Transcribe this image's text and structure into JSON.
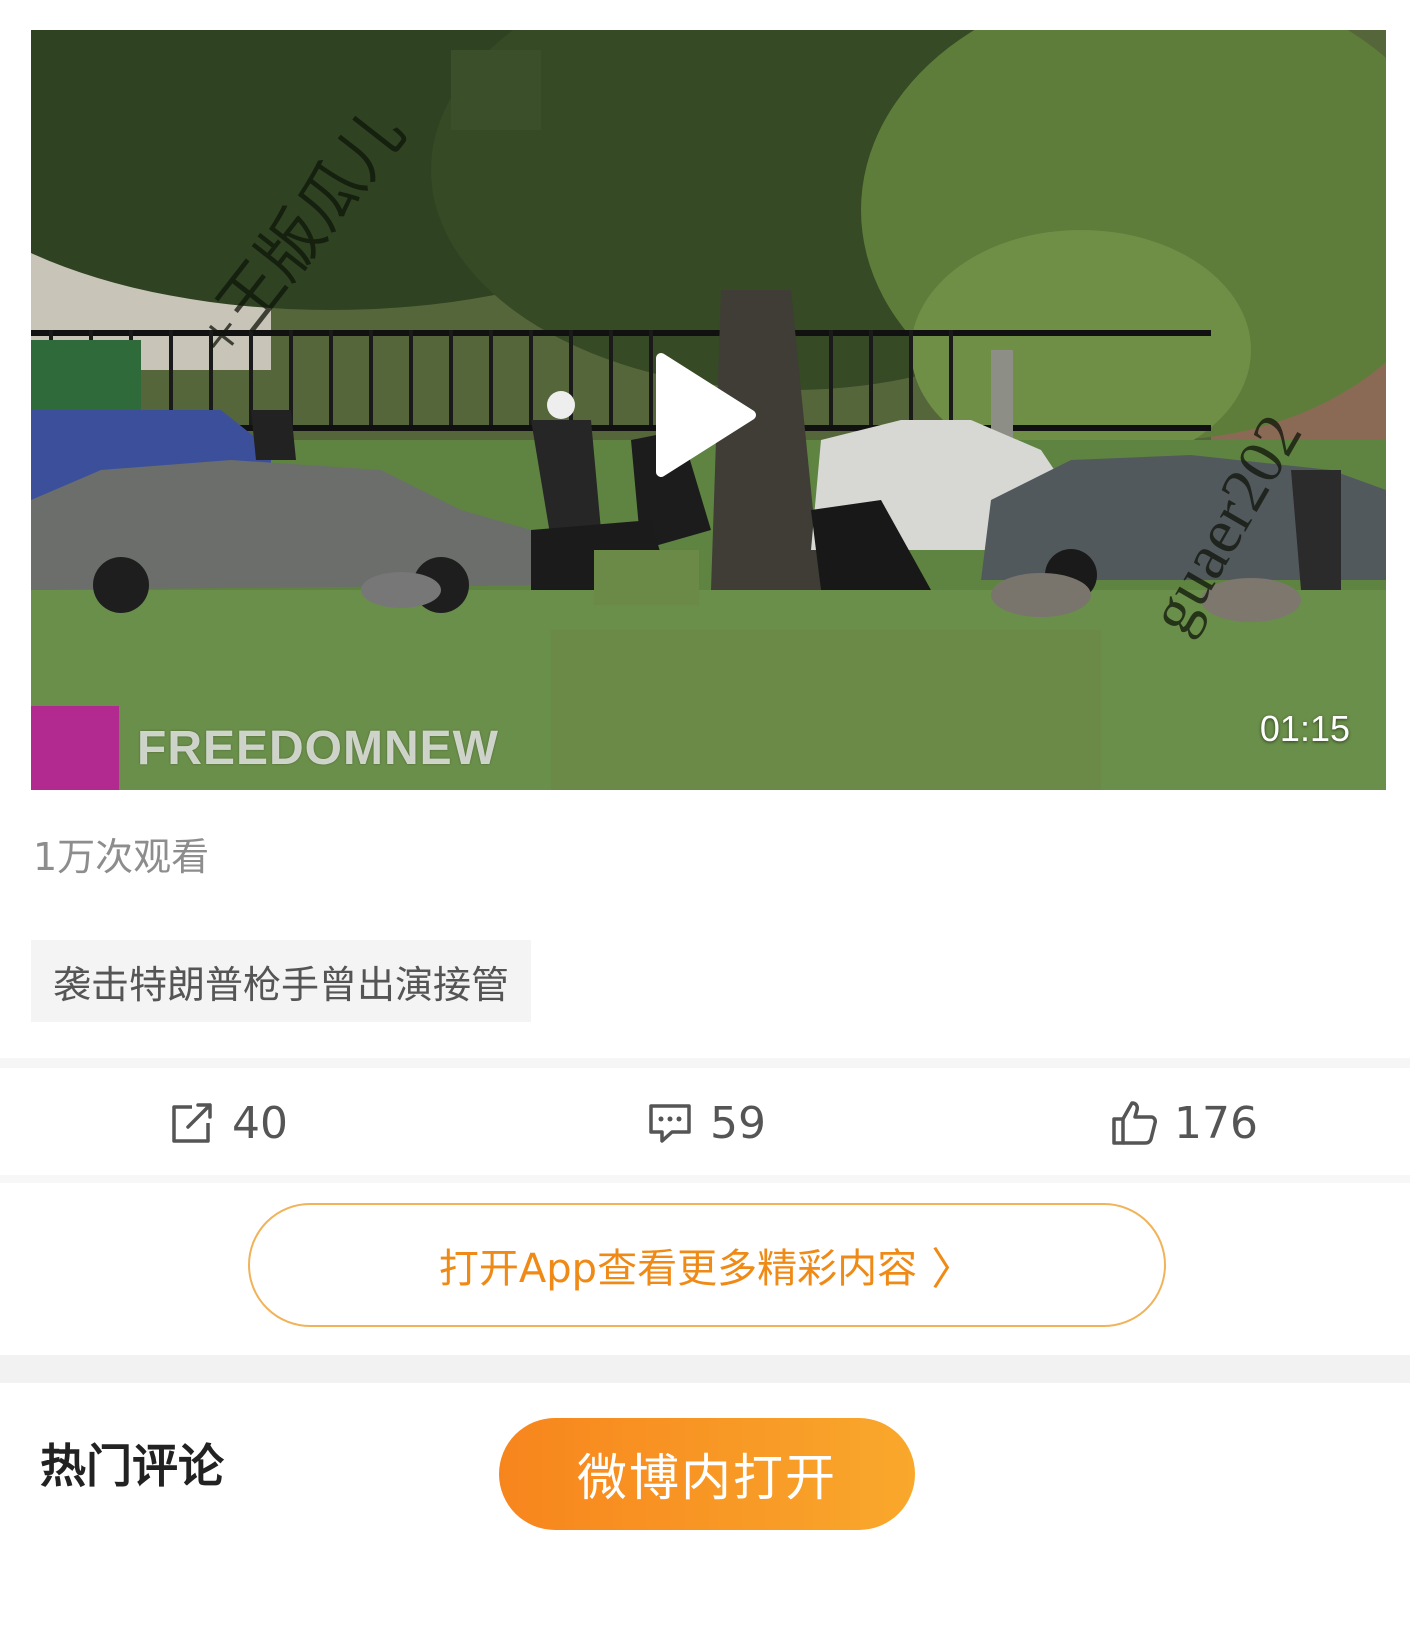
{
  "video": {
    "duration": "01:15",
    "channel_name": "FREEDOMNEW",
    "watermark_left": "+王版瓜儿",
    "watermark_right": "guaer202"
  },
  "meta": {
    "views": "1万次观看",
    "topic": "袭击特朗普枪手曾出演接管"
  },
  "actions": {
    "repost_count": "40",
    "comment_count": "59",
    "like_count": "176"
  },
  "open_app": {
    "label": "打开App查看更多精彩内容",
    "chevron": "〉"
  },
  "comments": {
    "title": "热门评论"
  },
  "open_weibo": {
    "label": "微博内打开"
  },
  "colors": {
    "accent": "#f08a16",
    "button_gradient_start": "#f7851d",
    "button_gradient_end": "#f9a82c"
  },
  "icons": [
    "play-icon",
    "repost-icon",
    "comment-icon",
    "like-icon",
    "chevron-right-icon"
  ]
}
